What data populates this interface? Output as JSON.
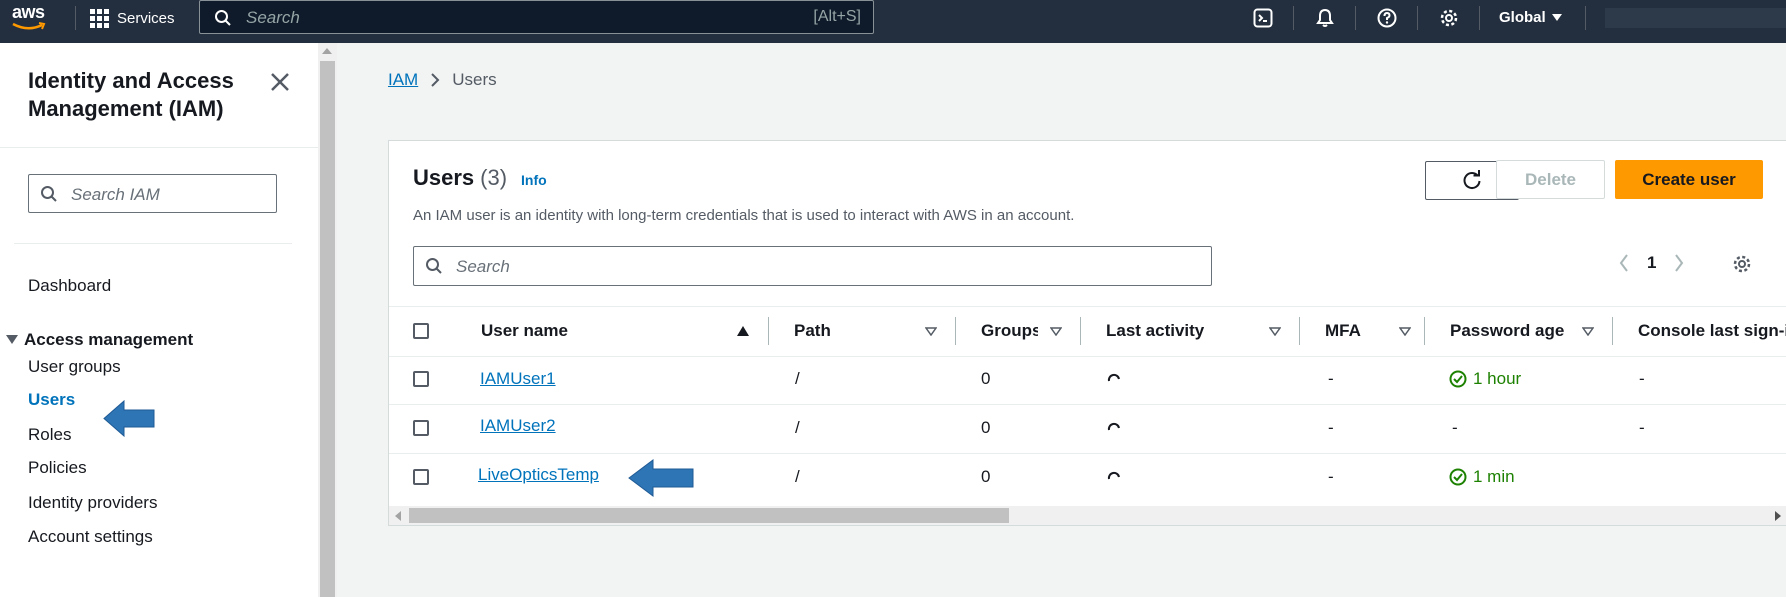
{
  "topbar": {
    "logo": "aws",
    "services_label": "Services",
    "search_placeholder": "Search",
    "search_shortcut": "[Alt+S]",
    "region_label": "Global"
  },
  "sidebar": {
    "title": "Identity and Access Management (IAM)",
    "search_placeholder": "Search IAM",
    "dashboard": "Dashboard",
    "section_label": "Access management",
    "items": [
      "User groups",
      "Users",
      "Roles",
      "Policies",
      "Identity providers",
      "Account settings"
    ],
    "active_item": "Users"
  },
  "breadcrumb": {
    "root": "IAM",
    "current": "Users"
  },
  "users_panel": {
    "title": "Users",
    "count": "(3)",
    "info_link": "Info",
    "description": "An IAM user is an identity with long-term credentials that is used to interact with AWS in an account.",
    "delete_label": "Delete",
    "create_label": "Create user",
    "search_placeholder": "Search",
    "page_number": "1",
    "columns": [
      "User name",
      "Path",
      "Groups",
      "Last activity",
      "MFA",
      "Password age",
      "Console last sign-in"
    ],
    "rows": [
      {
        "user_name": "IAMUser1",
        "path": "/",
        "groups": "0",
        "mfa": "-",
        "password_age": "1 hour",
        "console_last_signin": "-"
      },
      {
        "user_name": "IAMUser2",
        "path": "/",
        "groups": "0",
        "mfa": "-",
        "password_age": "-",
        "console_last_signin": "-"
      },
      {
        "user_name": "LiveOpticsTemp",
        "path": "/",
        "groups": "0",
        "mfa": "-",
        "password_age": "1 min",
        "console_last_signin": ""
      }
    ]
  },
  "colors": {
    "topbar_bg": "#232f3e",
    "link": "#0073bb",
    "primary_button": "#ff9900",
    "success_green": "#1d8102",
    "annotation_arrow": "#2e75b6"
  },
  "icons": [
    "aws-logo",
    "grid-icon",
    "search-icon",
    "cloudshell-icon",
    "bell-icon",
    "help-icon",
    "settings-icon",
    "caret-down-icon",
    "close-icon",
    "refresh-icon",
    "chevron-left-icon",
    "chevron-right-icon",
    "sort-asc-icon",
    "filter-caret-icon",
    "spinner-icon",
    "check-circle-icon",
    "blue-arrow-annotation"
  ]
}
